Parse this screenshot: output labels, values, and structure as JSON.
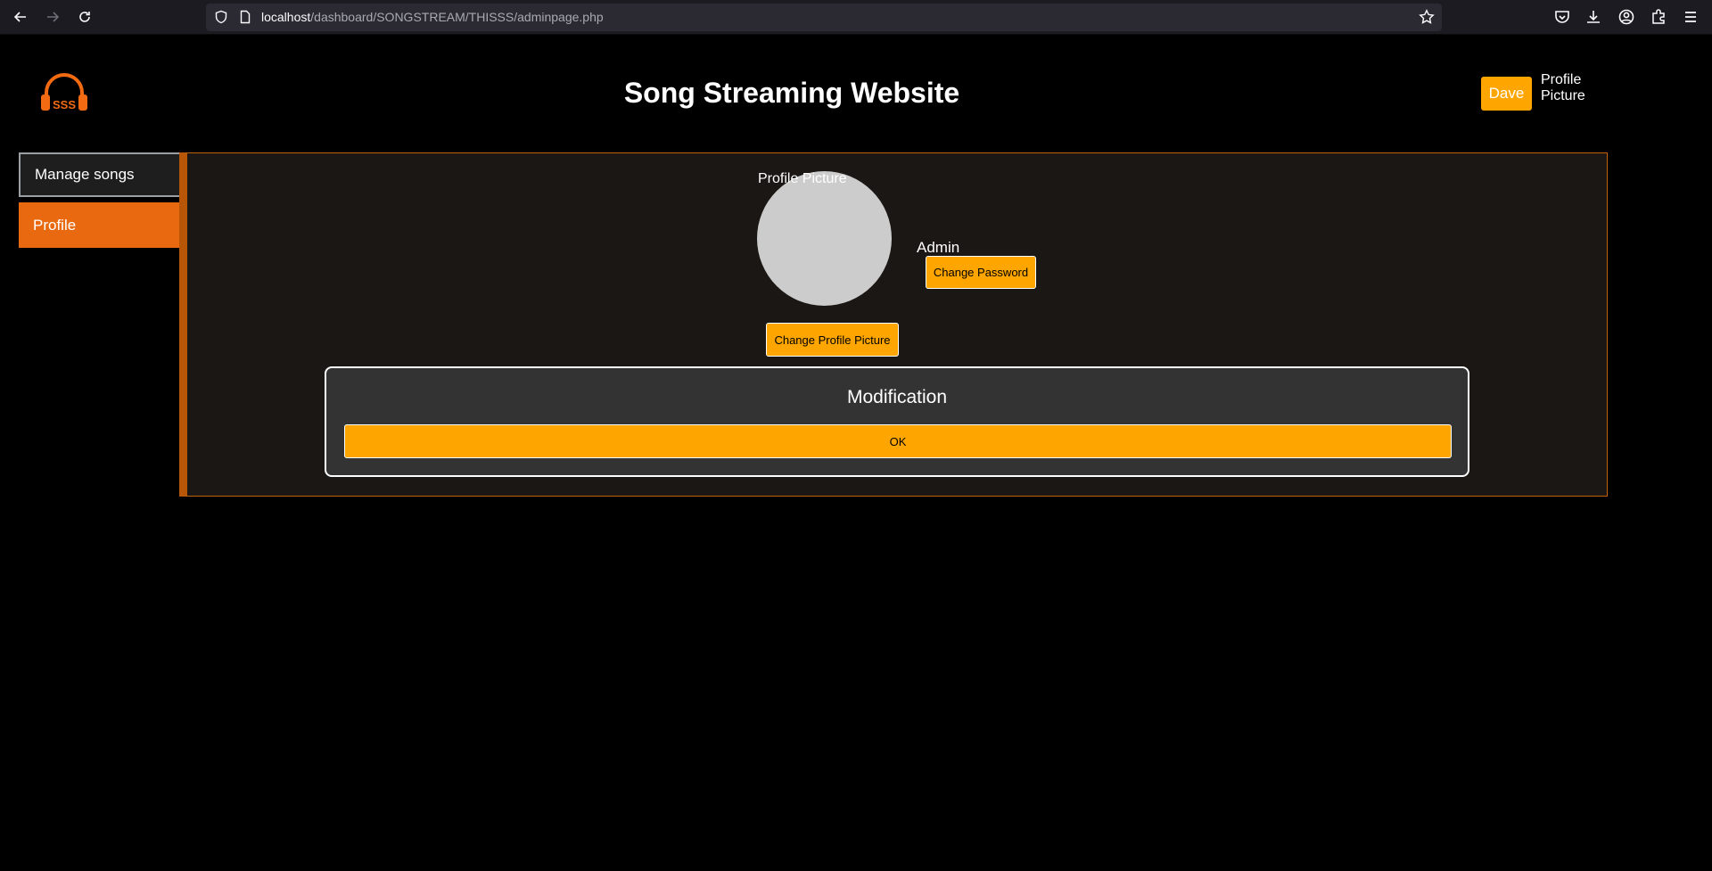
{
  "browser": {
    "url_host": "localhost",
    "url_path": "/dashboard/SONGSTREAM/THISSS/adminpage.php"
  },
  "header": {
    "title": "Song Streaming Website",
    "user_button": "Dave",
    "avatar_alt": "Profile Picture",
    "logo_text": "SSS"
  },
  "sidebar": {
    "items": [
      {
        "label": "Manage songs"
      },
      {
        "label": "Profile"
      }
    ]
  },
  "profile": {
    "avatar_alt": "Profile Picture",
    "role": "Admin",
    "change_password_label": "Change Password",
    "change_picture_label": "Change Profile Picture"
  },
  "modal": {
    "title": "Modification",
    "ok_label": "OK"
  },
  "colors": {
    "accent": "#ffa500",
    "sidebar_active": "#e8690f",
    "panel_border": "#c2620c",
    "logo": "#f26b12"
  }
}
